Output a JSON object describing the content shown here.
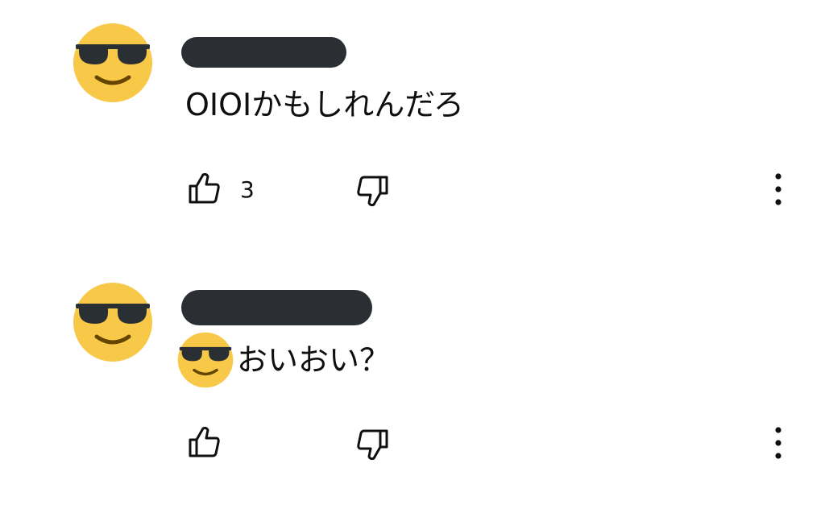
{
  "comments": [
    {
      "avatar_icon": "sunglasses-emoji-icon",
      "author_redacted": true,
      "text": "OIOIかもしれんだろ",
      "text_prefix_emoji": null,
      "like_count": "3"
    },
    {
      "avatar_icon": "sunglasses-emoji-icon",
      "author_redacted": true,
      "text": "おいおい？",
      "text_prefix_emoji": "sunglasses-emoji-icon",
      "like_count": ""
    }
  ],
  "icons": {
    "like": "thumbs-up-icon",
    "dislike": "thumbs-down-icon",
    "more": "more-vertical-icon"
  },
  "colors": {
    "redaction": "#2b2f33",
    "emoji_face": "#f8c948",
    "emoji_glasses": "#292f33",
    "emoji_mouth": "#664500",
    "icon_stroke": "#0f0f0f"
  }
}
